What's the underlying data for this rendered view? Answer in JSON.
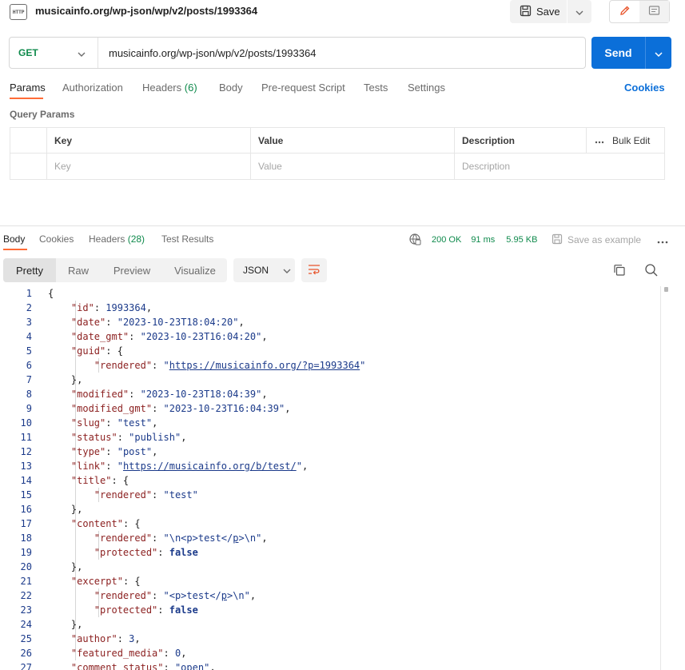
{
  "window": {
    "icon_label": "HTTP",
    "title": "musicainfo.org/wp-json/wp/v2/posts/1993364",
    "save_label": "Save"
  },
  "request": {
    "method": "GET",
    "url": "musicainfo.org/wp-json/wp/v2/posts/1993364",
    "send_label": "Send"
  },
  "request_tabs": {
    "params": "Params",
    "authorization": "Authorization",
    "headers": "Headers",
    "headers_count": "(6)",
    "body": "Body",
    "prerequest": "Pre-request Script",
    "tests": "Tests",
    "settings": "Settings",
    "cookies": "Cookies"
  },
  "query_params": {
    "label": "Query Params",
    "columns": {
      "key": "Key",
      "value": "Value",
      "description": "Description",
      "bulk_edit": "Bulk Edit"
    },
    "placeholders": {
      "key": "Key",
      "value": "Value",
      "description": "Description"
    }
  },
  "response_tabs": {
    "body": "Body",
    "cookies": "Cookies",
    "headers": "Headers",
    "headers_count": "(28)",
    "test_results": "Test Results"
  },
  "response_status": {
    "status": "200 OK",
    "time": "91 ms",
    "size": "5.95 KB",
    "save_example": "Save as example"
  },
  "format_toolbar": {
    "pretty": "Pretty",
    "raw": "Raw",
    "preview": "Preview",
    "visualize": "Visualize",
    "format": "JSON",
    "active": "Pretty"
  },
  "colors": {
    "accent_orange": "#ff6c37",
    "send_blue": "#0b6fd9",
    "status_green": "#0f8a4c",
    "json_key": "#8b1f1f",
    "json_value": "#1b3a8a"
  },
  "code_lines": [
    {
      "n": "1",
      "t": [
        [
          "p",
          "{"
        ]
      ]
    },
    {
      "n": "2",
      "t": [
        [
          "p",
          "    "
        ],
        [
          "k",
          "\"id\""
        ],
        [
          "p",
          ": "
        ],
        [
          "n",
          "1993364"
        ],
        [
          "p",
          ","
        ]
      ]
    },
    {
      "n": "3",
      "t": [
        [
          "p",
          "    "
        ],
        [
          "k",
          "\"date\""
        ],
        [
          "p",
          ": "
        ],
        [
          "s",
          "\"2023-10-23T18:04:20\""
        ],
        [
          "p",
          ","
        ]
      ]
    },
    {
      "n": "4",
      "t": [
        [
          "p",
          "    "
        ],
        [
          "k",
          "\"date_gmt\""
        ],
        [
          "p",
          ": "
        ],
        [
          "s",
          "\"2023-10-23T16:04:20\""
        ],
        [
          "p",
          ","
        ]
      ]
    },
    {
      "n": "5",
      "t": [
        [
          "p",
          "    "
        ],
        [
          "k",
          "\"guid\""
        ],
        [
          "p",
          ": {"
        ]
      ]
    },
    {
      "n": "6",
      "t": [
        [
          "p",
          "        "
        ],
        [
          "k",
          "\"rendered\""
        ],
        [
          "p",
          ": "
        ],
        [
          "s",
          "\""
        ],
        [
          "u",
          "https://musicainfo.org/?p=1993364"
        ],
        [
          "s",
          "\""
        ]
      ]
    },
    {
      "n": "7",
      "t": [
        [
          "p",
          "    },"
        ]
      ]
    },
    {
      "n": "8",
      "t": [
        [
          "p",
          "    "
        ],
        [
          "k",
          "\"modified\""
        ],
        [
          "p",
          ": "
        ],
        [
          "s",
          "\"2023-10-23T18:04:39\""
        ],
        [
          "p",
          ","
        ]
      ]
    },
    {
      "n": "9",
      "t": [
        [
          "p",
          "    "
        ],
        [
          "k",
          "\"modified_gmt\""
        ],
        [
          "p",
          ": "
        ],
        [
          "s",
          "\"2023-10-23T16:04:39\""
        ],
        [
          "p",
          ","
        ]
      ]
    },
    {
      "n": "10",
      "t": [
        [
          "p",
          "    "
        ],
        [
          "k",
          "\"slug\""
        ],
        [
          "p",
          ": "
        ],
        [
          "s",
          "\"test\""
        ],
        [
          "p",
          ","
        ]
      ]
    },
    {
      "n": "11",
      "t": [
        [
          "p",
          "    "
        ],
        [
          "k",
          "\"status\""
        ],
        [
          "p",
          ": "
        ],
        [
          "s",
          "\"publish\""
        ],
        [
          "p",
          ","
        ]
      ]
    },
    {
      "n": "12",
      "t": [
        [
          "p",
          "    "
        ],
        [
          "k",
          "\"type\""
        ],
        [
          "p",
          ": "
        ],
        [
          "s",
          "\"post\""
        ],
        [
          "p",
          ","
        ]
      ]
    },
    {
      "n": "13",
      "t": [
        [
          "p",
          "    "
        ],
        [
          "k",
          "\"link\""
        ],
        [
          "p",
          ": "
        ],
        [
          "s",
          "\""
        ],
        [
          "u",
          "https://musicainfo.org/b/test/"
        ],
        [
          "s",
          "\""
        ],
        [
          "p",
          ","
        ]
      ]
    },
    {
      "n": "14",
      "t": [
        [
          "p",
          "    "
        ],
        [
          "k",
          "\"title\""
        ],
        [
          "p",
          ": {"
        ]
      ]
    },
    {
      "n": "15",
      "t": [
        [
          "p",
          "        "
        ],
        [
          "k",
          "\"rendered\""
        ],
        [
          "p",
          ": "
        ],
        [
          "s",
          "\"test\""
        ]
      ]
    },
    {
      "n": "16",
      "t": [
        [
          "p",
          "    },"
        ]
      ]
    },
    {
      "n": "17",
      "t": [
        [
          "p",
          "    "
        ],
        [
          "k",
          "\"content\""
        ],
        [
          "p",
          ": {"
        ]
      ]
    },
    {
      "n": "18",
      "t": [
        [
          "p",
          "        "
        ],
        [
          "k",
          "\"rendered\""
        ],
        [
          "p",
          ": "
        ],
        [
          "s",
          "\"\\n<p>test</"
        ],
        [
          "u",
          "p"
        ],
        [
          "s",
          ">\\n\""
        ],
        [
          "p",
          ","
        ]
      ]
    },
    {
      "n": "19",
      "t": [
        [
          "p",
          "        "
        ],
        [
          "k",
          "\"protected\""
        ],
        [
          "p",
          ": "
        ],
        [
          "b",
          "false"
        ]
      ]
    },
    {
      "n": "20",
      "t": [
        [
          "p",
          "    },"
        ]
      ]
    },
    {
      "n": "21",
      "t": [
        [
          "p",
          "    "
        ],
        [
          "k",
          "\"excerpt\""
        ],
        [
          "p",
          ": {"
        ]
      ]
    },
    {
      "n": "22",
      "t": [
        [
          "p",
          "        "
        ],
        [
          "k",
          "\"rendered\""
        ],
        [
          "p",
          ": "
        ],
        [
          "s",
          "\"<p>test</"
        ],
        [
          "u",
          "p"
        ],
        [
          "s",
          ">\\n\""
        ],
        [
          "p",
          ","
        ]
      ]
    },
    {
      "n": "23",
      "t": [
        [
          "p",
          "        "
        ],
        [
          "k",
          "\"protected\""
        ],
        [
          "p",
          ": "
        ],
        [
          "b",
          "false"
        ]
      ]
    },
    {
      "n": "24",
      "t": [
        [
          "p",
          "    },"
        ]
      ]
    },
    {
      "n": "25",
      "t": [
        [
          "p",
          "    "
        ],
        [
          "k",
          "\"author\""
        ],
        [
          "p",
          ": "
        ],
        [
          "n",
          "3"
        ],
        [
          "p",
          ","
        ]
      ]
    },
    {
      "n": "26",
      "t": [
        [
          "p",
          "    "
        ],
        [
          "k",
          "\"featured_media\""
        ],
        [
          "p",
          ": "
        ],
        [
          "n",
          "0"
        ],
        [
          "p",
          ","
        ]
      ]
    },
    {
      "n": "27",
      "t": [
        [
          "p",
          "    "
        ],
        [
          "k",
          "\"comment_status\""
        ],
        [
          "p",
          ": "
        ],
        [
          "s",
          "\"open\""
        ],
        [
          "p",
          ","
        ]
      ]
    }
  ]
}
